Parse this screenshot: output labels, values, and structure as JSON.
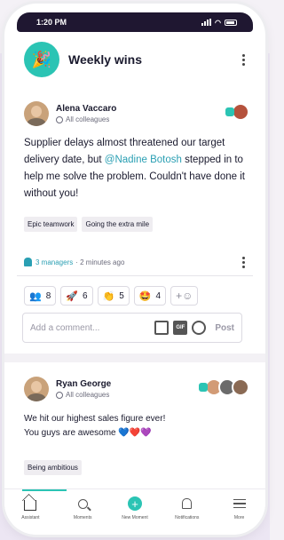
{
  "status_bar": {
    "time": "1:20 PM"
  },
  "header": {
    "title": "Weekly wins",
    "logo_icon": "🎉"
  },
  "post1": {
    "author": "Alena Vaccaro",
    "audience": "All colleagues",
    "body_before": "Supplier delays almost threatened our target delivery date, but ",
    "mention": "@Nadine Botosh",
    "body_after": " stepped in to help me solve the problem. Couldn't have done it without you!",
    "badges": [
      "Epic teamwork",
      "Going the extra mile"
    ],
    "managers": "3 managers",
    "time": "· 2 minutes ago",
    "reactions": [
      {
        "icon": "👥",
        "count": "8"
      },
      {
        "icon": "🚀",
        "count": "6"
      },
      {
        "icon": "👏",
        "count": "5"
      },
      {
        "icon": "🤩",
        "count": "4"
      }
    ],
    "add_reaction": "+☺",
    "comment_placeholder": "Add a comment...",
    "gif_label": "GIF",
    "post_button": "Post"
  },
  "post2": {
    "author": "Ryan George",
    "audience": "All colleagues",
    "body_line1": "We hit our highest sales figure ever!",
    "body_line2": "You guys are awesome 💙❤️💜",
    "badges": [
      "Being ambitious"
    ]
  },
  "tabbar": {
    "tabs": [
      {
        "label": "Assistant",
        "icon": "home-icon"
      },
      {
        "label": "Moments",
        "icon": "search-icon"
      },
      {
        "label": "New Moment",
        "icon": "plus-icon"
      },
      {
        "label": "Notifications",
        "icon": "bell-icon"
      },
      {
        "label": "More",
        "icon": "menu-icon"
      }
    ]
  },
  "colors": {
    "accent": "#2bc4b4",
    "mention": "#2a9fb3",
    "status_bar": "#1f1731"
  }
}
